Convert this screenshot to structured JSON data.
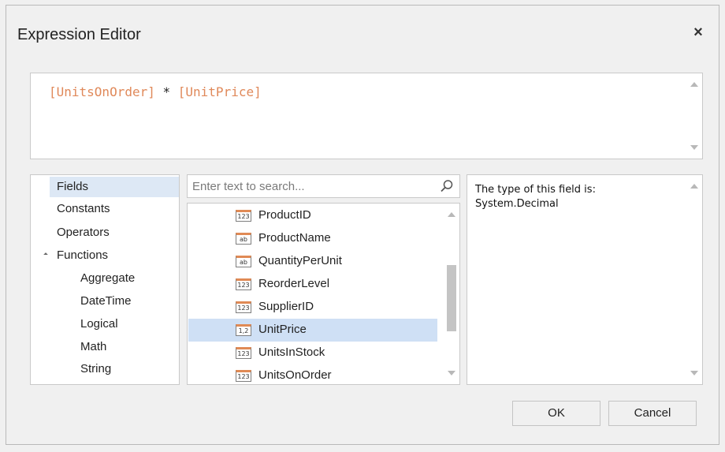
{
  "dialog": {
    "title": "Expression Editor",
    "close_label": "×"
  },
  "expression": {
    "field1": "[UnitsOnOrder]",
    "operator": " * ",
    "field2": "[UnitPrice]"
  },
  "categories": {
    "items": [
      {
        "label": "Fields",
        "selected": true
      },
      {
        "label": "Constants"
      },
      {
        "label": "Operators"
      },
      {
        "label": "Functions",
        "expanded": true
      },
      {
        "label": "Aggregate"
      },
      {
        "label": "DateTime"
      },
      {
        "label": "Logical"
      },
      {
        "label": "Math"
      },
      {
        "label": "String"
      }
    ]
  },
  "search": {
    "placeholder": "Enter text to search..."
  },
  "fields": [
    {
      "name": "ProductID",
      "type_icon": "123"
    },
    {
      "name": "ProductName",
      "type_icon": "ab"
    },
    {
      "name": "QuantityPerUnit",
      "type_icon": "ab"
    },
    {
      "name": "ReorderLevel",
      "type_icon": "123"
    },
    {
      "name": "SupplierID",
      "type_icon": "123"
    },
    {
      "name": "UnitPrice",
      "type_icon": "1,2",
      "selected": true
    },
    {
      "name": "UnitsInStock",
      "type_icon": "123"
    },
    {
      "name": "UnitsOnOrder",
      "type_icon": "123"
    }
  ],
  "description": {
    "line1": "The type of this field is:",
    "line2": "System.Decimal"
  },
  "buttons": {
    "ok": "OK",
    "cancel": "Cancel"
  },
  "colors": {
    "field_token": "#e0895a",
    "selection": "#cfe0f5",
    "icon_accent": "#e08a55"
  }
}
